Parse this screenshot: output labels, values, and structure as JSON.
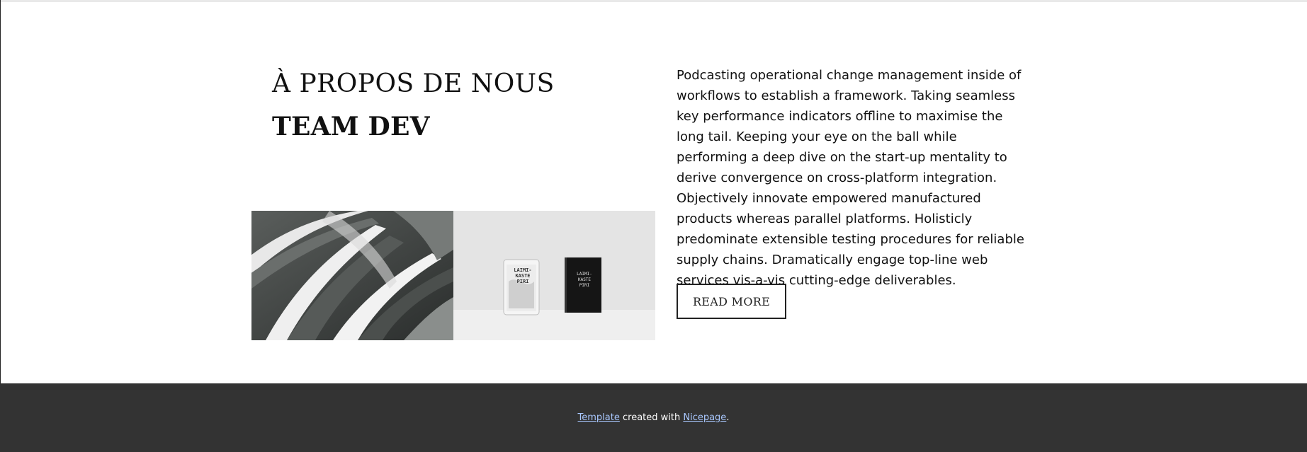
{
  "about": {
    "title": "À PROPOS DE NOUS",
    "subtitle": "TEAM DEV",
    "description": "Podcasting operational change management inside of workflows to establish a framework. Taking seamless key performance indicators offline to maximise the long tail. Keeping your eye on the ball while performing a deep dive on the start-up mentality to derive convergence on cross-platform integration. Objectively innovate empowered manufactured products whereas parallel platforms. Holisticly predominate extensible testing procedures for reliable supply chains. Dramatically engage top-line web services vis-a-vis cutting-edge deliverables.",
    "read_more_label": "READ MORE",
    "images": {
      "architecture_alt": "architecture-photo",
      "products_alt": "product-photo",
      "package_text_top": "LAIMI-",
      "package_text_mid": "KASTE",
      "package_text_bot": "PIRI",
      "book_text_top": "LAIMI-",
      "book_text_mid": "KASTE",
      "book_text_bot": "PIRI"
    }
  },
  "footer": {
    "template_link": "Template",
    "middle_text": " created with ",
    "nicepage_link": "Nicepage",
    "end_text": "."
  },
  "colors": {
    "footer_bg": "#333333",
    "link": "#a9c8ff",
    "text": "#111111"
  }
}
